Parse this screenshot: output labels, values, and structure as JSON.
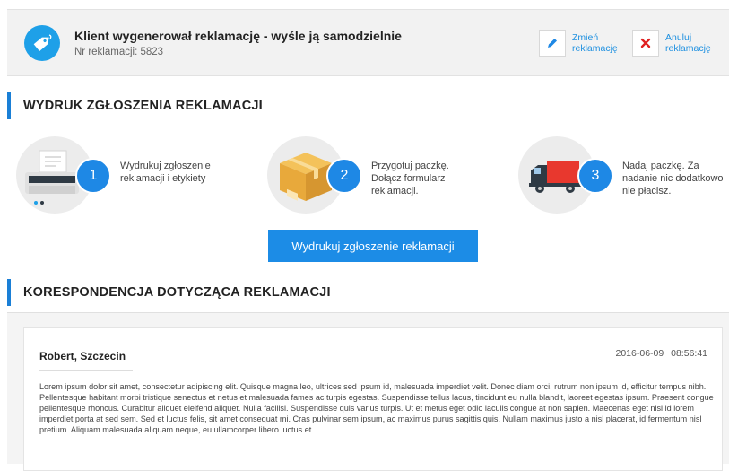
{
  "header": {
    "title": "Klient wygenerował reklamację - wyśle ją samodzielnie",
    "subtitle": "Nr reklamacji: 5823",
    "tag_icon": "tag-icon",
    "edit_label": "Zmień\nreklamację",
    "cancel_label": "Anuluj\nreklamację",
    "accent": "#1ea0e8"
  },
  "print_section": {
    "heading": "WYDRUK ZGŁOSZENIA REKLAMACJI",
    "steps": [
      {
        "number": "1",
        "text": "Wydrukuj zgłoszenie reklamacji i etykiety",
        "icon": "printer-icon"
      },
      {
        "number": "2",
        "text": "Przygotuj paczkę. Dołącz formularz reklamacji.",
        "icon": "package-icon"
      },
      {
        "number": "3",
        "text": "Nadaj paczkę. Za nadanie nic dodatkowo nie płacisz.",
        "icon": "truck-icon"
      }
    ],
    "button_label": "Wydrukuj zgłoszenie reklamacji"
  },
  "correspondence": {
    "heading": "KORESPONDENCJA DOTYCZĄCA REKLAMACJI",
    "messages": [
      {
        "author": "Robert, Szczecin",
        "date": "2016-06-09 08:56:41",
        "body": "Lorem ipsum dolor sit amet, consectetur adipiscing elit. Quisque magna leo, ultrices sed ipsum id, malesuada imperdiet velit. Donec diam orci, rutrum non ipsum id, efficitur tempus nibh. Pellentesque habitant morbi tristique senectus et netus et malesuada fames ac turpis egestas. Suspendisse tellus lacus, tincidunt eu nulla blandit, laoreet egestas ipsum. Praesent congue pellentesque rhoncus. Curabitur aliquet eleifend aliquet. Nulla facilisi. Suspendisse quis varius turpis. Ut et metus eget odio iaculis congue at non sapien. Maecenas eget nisl id lorem imperdiet porta at sed sem. Sed et luctus felis, sit amet consequat mi. Cras pulvinar sem ipsum, ac maximus purus sagittis quis. Nullam maximus justo a nisl placerat, id fermentum nisl pretium. Aliquam malesuada aliquam neque, eu ullamcorper libero luctus et."
      }
    ]
  }
}
